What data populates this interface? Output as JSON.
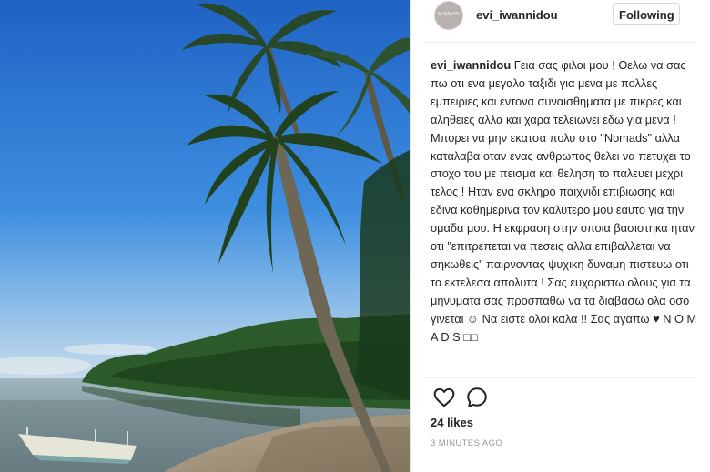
{
  "post": {
    "username": "evi_iwannidou",
    "follow_label": "Following",
    "avatar_text": "NOMADS",
    "caption_username": "evi_iwannidou",
    "caption_text": "Γεια σας φιλοι μου ! Θελω να σας πω οτι ενα μεγαλο ταξιδι για μενα με πολλες εμπειριες και εντονα συναισθηματα με πικρες και αληθειες αλλα και χαρα τελειωνει εδω για μενα ! Μπορει να μην εκατσα πολυ στο \"Nomads\" αλλα καταλαβα οταν ενας ανθρωπος θελει να πετυχει το στοχο του με πεισμα και θεληση το παλευει μεχρι τελος ! Ηταν ενα σκληρο παιχνιδι επιβιωσης και εδινα καθημερινα τον καλυτερο μου εαυτο για την ομαδα μου. Η εκφραση στην οποια βασιστηκα ηταν οτι \"επιτρεπεται να πεσεις αλλα επιβαλλεται να σηκωθεις\" παιρνοντας ψυχικη δυναμη πιστευω οτι το εκτελεσα απολυτα ! Σας ευχαριστω ολους για τα μηνυματα σας προσπαθω να τα διαβασω ολα οσο γινεται ☺ Να ειστε ολοι καλα !! Σας αγαπω ♥ N O M A D S □□",
    "likes": "24 likes",
    "time_ago": "3 MINUTES AGO"
  },
  "icons": {
    "like": "heart-outline-icon",
    "comment": "speech-bubble-icon"
  },
  "colors": {
    "text": "#262626",
    "muted": "#999999",
    "border": "#dbdbdb",
    "sky": "#2f7fd6"
  }
}
